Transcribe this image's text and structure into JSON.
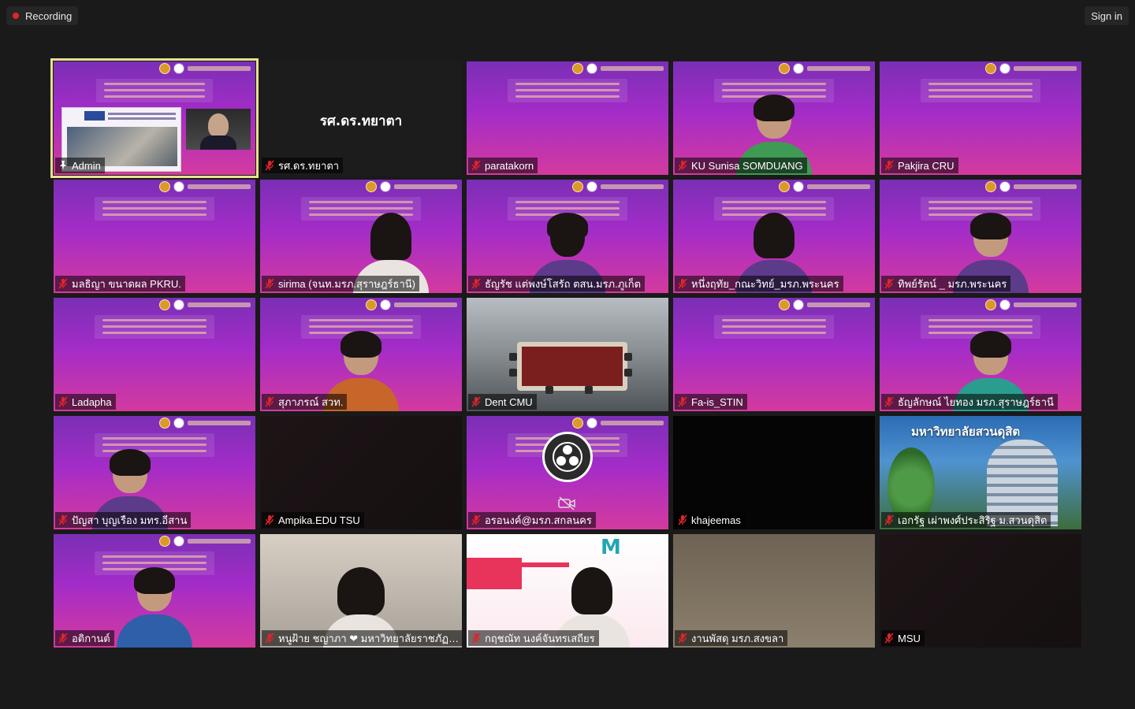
{
  "top_bar": {
    "recording_label": "Recording",
    "sign_in_label": "Sign in"
  },
  "colors": {
    "background": "#1a1a1a",
    "active_speaker_border": "#e6e28a",
    "recording_dot": "#e0242b"
  },
  "participants": [
    {
      "name": "Admin",
      "mic": "pin-icon",
      "active": true
    },
    {
      "name": "รศ.ดร.ทยาตา",
      "display_name": "รศ.ดร.ทยาตา",
      "mic": "mic-muted-icon"
    },
    {
      "name": "paratakorn",
      "mic": "mic-muted-icon"
    },
    {
      "name": "KU Sunisa SOMDUANG",
      "mic": "mic-muted-icon"
    },
    {
      "name": "Pakjira CRU",
      "mic": "mic-muted-icon"
    },
    {
      "name": "มลธิญา ขนาดผล PKRU.",
      "mic": "mic-muted-icon"
    },
    {
      "name": "sirima (จนท.มรภ.สุราษฎร์ธานี)",
      "mic": "mic-muted-icon"
    },
    {
      "name": "ธัญรัช แต่พงษ์โสรัถ ตสน.มรภ.ภูเก็ต",
      "mic": "mic-muted-icon"
    },
    {
      "name": "หนึ่งฤทัย_กณะวิทย์_มรภ.พระนคร",
      "mic": "mic-muted-icon"
    },
    {
      "name": "ทิพย์รัตน์ _ มรภ.พระนคร",
      "mic": "mic-muted-icon"
    },
    {
      "name": "Ladapha",
      "mic": "mic-muted-icon"
    },
    {
      "name": "สุภาภรณ์ สวท.",
      "mic": "mic-muted-icon"
    },
    {
      "name": "Dent CMU",
      "mic": "mic-muted-icon"
    },
    {
      "name": "Fa-is_STIN",
      "mic": "mic-muted-icon"
    },
    {
      "name": "ธัญลักษณ์ ไยทอง มรภ.สุราษฎร์ธานี",
      "mic": "mic-muted-icon"
    },
    {
      "name": "ปัญสา บุญเรือง มทร.อีสาน",
      "mic": "mic-muted-icon"
    },
    {
      "name": "Ampika.EDU TSU",
      "mic": "mic-muted-icon"
    },
    {
      "name": "อรอนงค์@มรภ.สกลนคร",
      "mic": "mic-muted-icon"
    },
    {
      "name": "khajeemas",
      "mic": "mic-muted-icon"
    },
    {
      "name": "เอกรัฐ เผ่าพงศ์ประสิริฐ ม.สวนดุสิต",
      "mic": "mic-muted-icon",
      "banner_text": "มหาวิทยาลัยสวนดุสิต"
    },
    {
      "name": "อติกานต์",
      "mic": "mic-muted-icon"
    },
    {
      "name": "หนูฝ้าย ชญาภา ❤ มหาวิทยาลัยราชภัฏภูเก็ต",
      "mic": "mic-muted-icon"
    },
    {
      "name": "กฤชณัท นงค์จันทรเสถียร",
      "mic": "mic-muted-icon"
    },
    {
      "name": "งานพัสดุ มรภ.สงขลา",
      "mic": "mic-muted-icon"
    },
    {
      "name": "MSU",
      "mic": "mic-muted-icon"
    }
  ]
}
